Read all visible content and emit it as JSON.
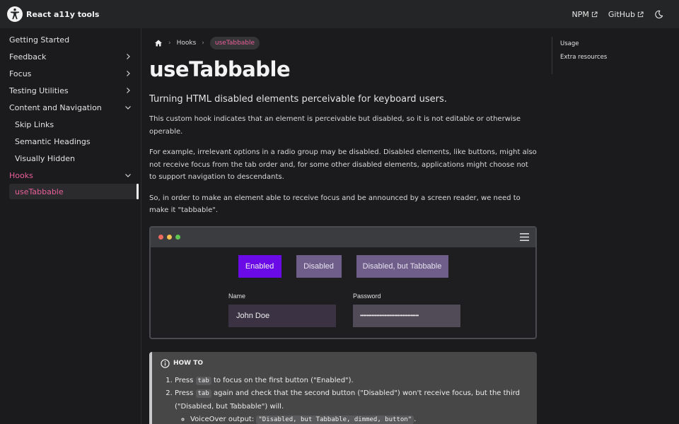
{
  "navbar": {
    "title": "React a11y tools",
    "links": [
      {
        "label": "NPM"
      },
      {
        "label": "GitHub"
      }
    ],
    "theme_icon": "moon-icon"
  },
  "sidebar": {
    "items": [
      {
        "label": "Getting Started"
      },
      {
        "label": "Feedback"
      },
      {
        "label": "Focus"
      },
      {
        "label": "Testing Utilities"
      },
      {
        "label": "Content and Navigation"
      },
      {
        "label": "Skip Links"
      },
      {
        "label": "Semantic Headings"
      },
      {
        "label": "Visually Hidden"
      },
      {
        "label": "Hooks"
      },
      {
        "label": "useTabbable"
      }
    ]
  },
  "breadcrumb": {
    "items": [
      "Hooks",
      "useTabbable"
    ],
    "home_icon": "home-icon"
  },
  "main": {
    "title": "useTabbable",
    "lead": "Turning HTML disabled elements perceivable for keyboard users.",
    "p1": "This custom hook indicates that an element is perceivable but disabled, so it is not editable or otherwise operable.",
    "p2": "For example, irrelevant options in a radio group may be disabled. Disabled elements, like buttons, might also not receive focus from the tab order and, for some other disabled elements, applications might choose not to support navigation to descendants.",
    "p3": "So, in order to make an element able to receive focus and be announced by a screen reader, we need to make it \"tabbable\"."
  },
  "demo": {
    "buttons": {
      "enabled": "Enabled",
      "disabled": "Disabled",
      "tabbable": "Disabled, but Tabbable"
    },
    "name_label": "Name",
    "name_value": "John Doe",
    "password_label": "Password",
    "password_value": "••••••••••••••••••••••••••••••••••••",
    "dot_colors": [
      "#ec6a5e",
      "#f4bf4f",
      "#61c554"
    ]
  },
  "howto": {
    "heading": "HOW TO",
    "step1_pre": "Press ",
    "step1_code": "tab",
    "step1_post": " to focus on the first button (\"Enabled\").",
    "step2_pre": "Press ",
    "step2_code": "tab",
    "step2_post": " again and check that the second button (\"Disabled\") won't receive focus, but the third (\"Disabled, but Tabbable\") will.",
    "sub_pre": "VoiceOver output: ",
    "sub_code": "\"Disabled, but Tabbable, dimmed, button\"",
    "sub_post": "."
  },
  "toc": {
    "items": [
      "Usage",
      "Extra resources"
    ]
  },
  "colors": {
    "accent": "#e95f9b",
    "enabled_button": "#6a0ae6",
    "disabled_button": "#6f5d8a"
  }
}
